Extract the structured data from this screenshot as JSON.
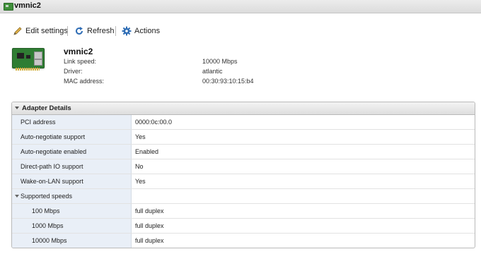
{
  "window": {
    "title": "vmnic2"
  },
  "toolbar": {
    "edit_label": "Edit settings",
    "refresh_label": "Refresh",
    "actions_label": "Actions"
  },
  "device": {
    "name": "vmnic2",
    "properties": [
      {
        "label": "Link speed:",
        "value": "10000 Mbps"
      },
      {
        "label": "Driver:",
        "value": "atlantic"
      },
      {
        "label": "MAC address:",
        "value": "00:30:93:10:15:b4"
      }
    ]
  },
  "adapter_details": {
    "header": "Adapter Details",
    "rows": [
      {
        "key": "PCI address",
        "value": "0000:0c:00.0"
      },
      {
        "key": "Auto-negotiate support",
        "value": "Yes"
      },
      {
        "key": "Auto-negotiate enabled",
        "value": "Enabled"
      },
      {
        "key": "Direct-path IO support",
        "value": "No"
      },
      {
        "key": "Wake-on-LAN support",
        "value": "Yes"
      }
    ],
    "speeds": {
      "label": "Supported speeds",
      "items": [
        {
          "key": "100 Mbps",
          "value": "full duplex"
        },
        {
          "key": "1000 Mbps",
          "value": "full duplex"
        },
        {
          "key": "10000 Mbps",
          "value": "full duplex"
        }
      ]
    }
  },
  "icons": {
    "title": "network-card-icon",
    "edit": "pencil-icon",
    "refresh": "refresh-icon",
    "actions": "gear-icon"
  },
  "colors": {
    "key_column_bg": "#e9eff7",
    "icon_blue": "#2f6db5",
    "card_green": "#2f7d33"
  }
}
